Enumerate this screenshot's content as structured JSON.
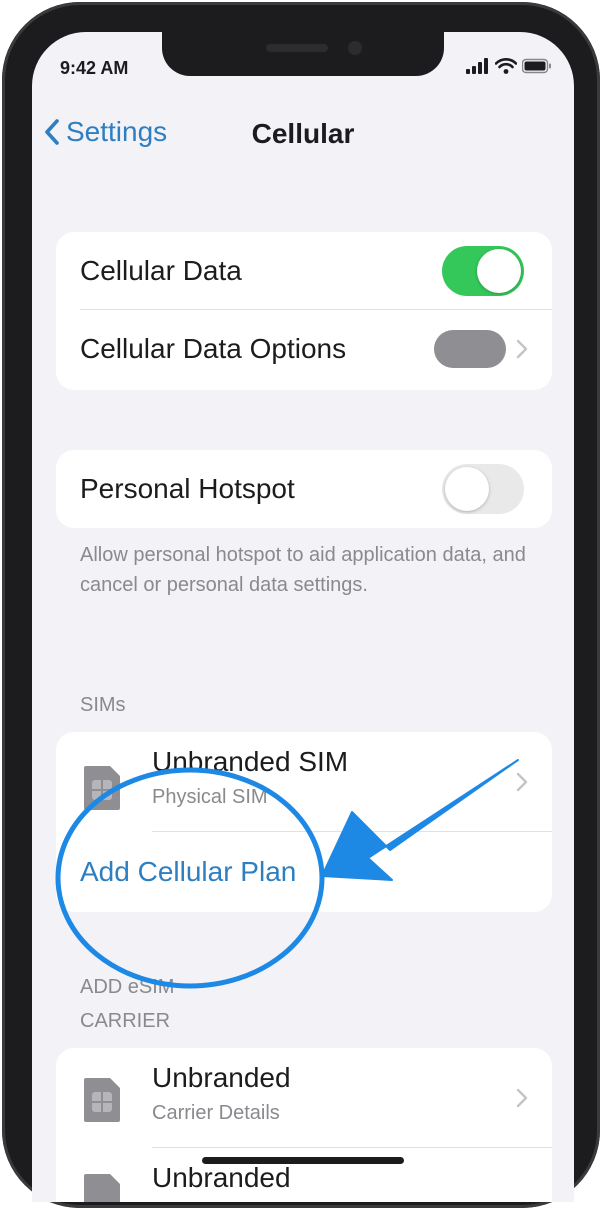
{
  "status_bar": {
    "time": "9:42 AM"
  },
  "nav": {
    "back_label": "Settings",
    "title": "Cellular"
  },
  "group1": {
    "cellular_data_label": "Cellular Data",
    "cellular_data_options_label": "Cellular Data Options"
  },
  "group2": {
    "hotspot_label": "Personal Hotspot",
    "footer": "Allow personal hotspot to aid application data, and cancel or personal data settings."
  },
  "sims": {
    "header": "SIMs",
    "sim_title": "Unbranded SIM",
    "sim_subtitle": "Physical SIM",
    "add_plan": "Add Cellular Plan"
  },
  "esim": {
    "header_line1": "ADD eSIM",
    "header_line2": "CARRIER",
    "carrier1_title": "Unbranded",
    "carrier1_subtitle": "Carrier Details",
    "carrier2_title": "Unbranded"
  },
  "colors": {
    "accent": "#2d7fc1",
    "toggle_on": "#34c759",
    "toggle_off": "#e9e9ea",
    "toggle_disabled": "#8e8e93",
    "annotation": "#1e88e5"
  },
  "toggles": {
    "cellular_data_on": true,
    "personal_hotspot_on": false
  }
}
